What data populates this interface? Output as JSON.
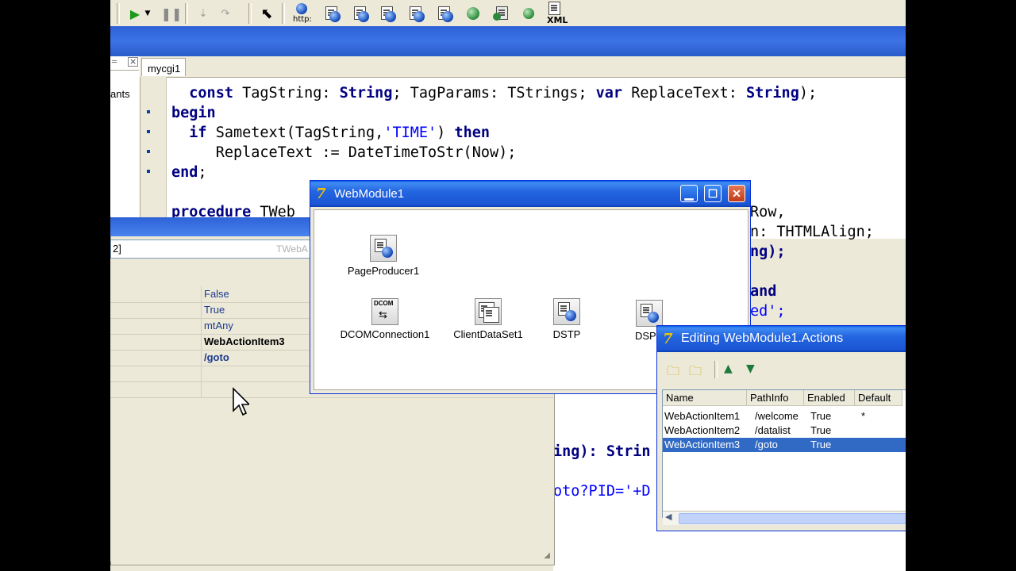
{
  "toolbar": {
    "icons": [
      "run-icon",
      "dropdown-arrow-icon",
      "pause-icon",
      "trace-into-icon",
      "step-over-icon",
      "pointer-arrow-icon",
      "http-icon",
      "web-component-icon",
      "xml-icon"
    ],
    "http_label": "http:",
    "xml_label": "XML"
  },
  "inspector_left_label": "ants",
  "editor": {
    "tab_label": "mycgi1",
    "lines": [
      "  const TagString: String; TagParams: TStrings; var ReplaceText: String);",
      "begin",
      "  if Sametext(TagString,'TIME') then",
      "     ReplaceText := DateTimeToStr(Now);",
      "end;",
      "",
      "procedure TWeb"
    ],
    "right_fragments": [
      "Row,",
      "n: THTMLAlign;",
      "ng);",
      "and",
      "ed';"
    ],
    "lower_fragment_1a": "ing): ",
    "lower_fragment_1b": "Strin",
    "lower_fragment_2": "oto?PID='+D"
  },
  "inspector": {
    "combo_left": "2]",
    "combo_right": "TWebA",
    "values": [
      "False",
      "True",
      "mtAny",
      "WebActionItem3",
      "/goto"
    ]
  },
  "webmodule": {
    "title": "WebModule1",
    "components": [
      {
        "name": "PageProducer1"
      },
      {
        "name": "DCOMConnection1"
      },
      {
        "name": "ClientDataSet1"
      },
      {
        "name": "DSTP"
      },
      {
        "name": "DSPR"
      }
    ],
    "dcom_icon_text": "DCOM"
  },
  "actions_editor": {
    "title": "Editing WebModule1.Actions",
    "columns": [
      "Name",
      "PathInfo",
      "Enabled",
      "Default"
    ],
    "rows": [
      {
        "name": "WebActionItem1",
        "path": "/welcome",
        "enabled": "True",
        "default": "*"
      },
      {
        "name": "WebActionItem2",
        "path": "/datalist",
        "enabled": "True",
        "default": ""
      },
      {
        "name": "WebActionItem3",
        "path": "/goto",
        "enabled": "True",
        "default": ""
      }
    ]
  }
}
